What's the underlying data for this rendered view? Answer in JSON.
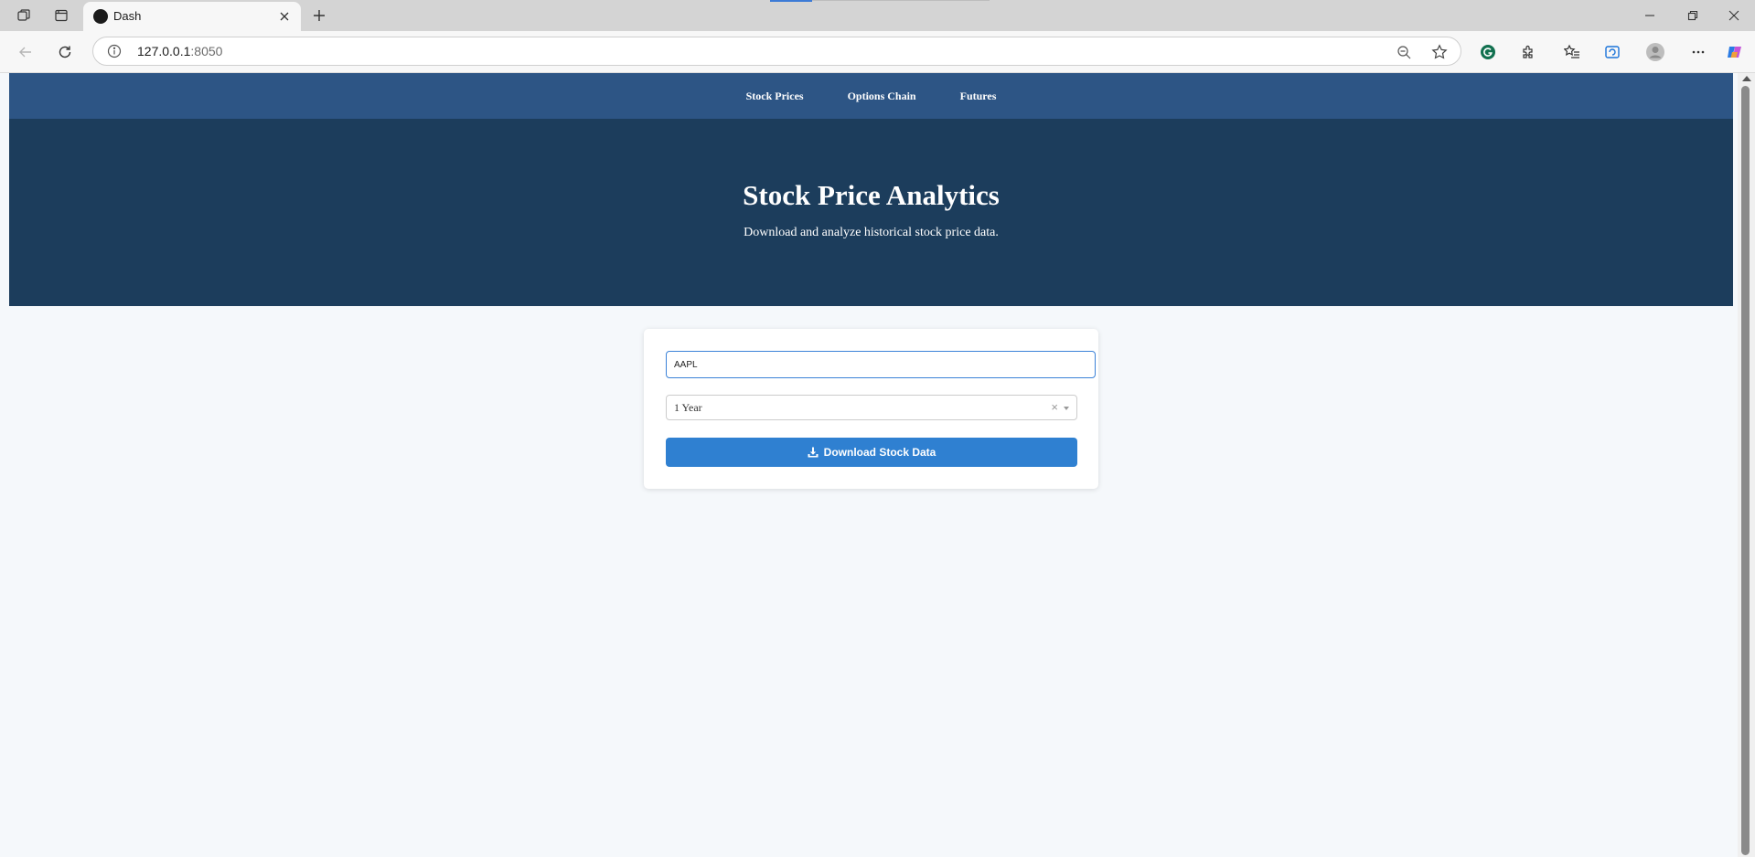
{
  "browser": {
    "tab_title": "Dash",
    "url_host": "127.0.0.1",
    "url_port": ":8050",
    "accent_color": "#3d7bd6"
  },
  "navbar": {
    "links": [
      "Stock Prices",
      "Options Chain",
      "Futures"
    ],
    "background": "#2d5585"
  },
  "hero": {
    "title": "Stock Price Analytics",
    "subtitle": "Download and analyze historical stock price data.",
    "background": "#1c3d5c"
  },
  "form": {
    "ticker_value": "AAPL",
    "period_selected": "1 Year",
    "clear_glyph": "×",
    "download_label": "Download Stock Data",
    "download_icon": "download-icon",
    "button_color": "#2f80d1"
  }
}
